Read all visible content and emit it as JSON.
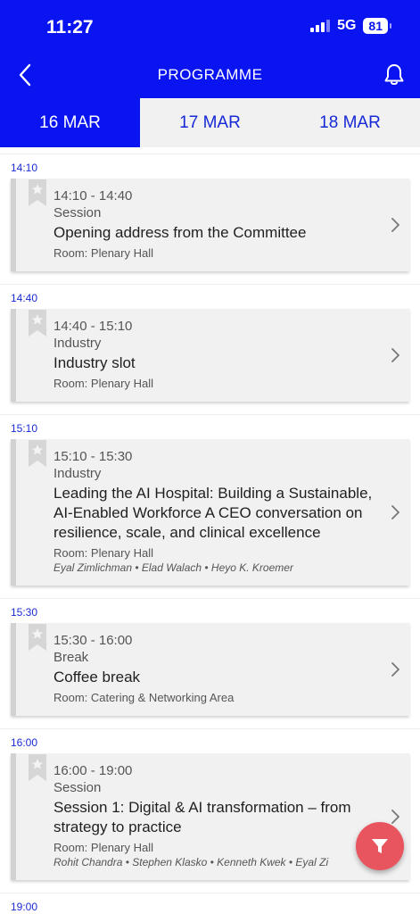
{
  "status": {
    "time": "11:27",
    "network": "5G",
    "battery": "81"
  },
  "header": {
    "title": "PROGRAMME",
    "back_icon": "chevron-left-icon",
    "bell_icon": "bell-icon"
  },
  "tabs": [
    {
      "label": "16 MAR",
      "active": true
    },
    {
      "label": "17 MAR",
      "active": false
    },
    {
      "label": "18 MAR",
      "active": false
    }
  ],
  "slots": [
    {
      "heading": "14:10",
      "time": "14:10 - 14:40",
      "type": "Session",
      "title": "Opening address from the Committee",
      "room": "Room: Plenary Hall",
      "speakers": ""
    },
    {
      "heading": "14:40",
      "time": "14:40 - 15:10",
      "type": "Industry",
      "title": "Industry slot",
      "room": "Room: Plenary Hall",
      "speakers": ""
    },
    {
      "heading": "15:10",
      "time": "15:10 - 15:30",
      "type": "Industry",
      "title": "Leading the AI Hospital: Building a Sustainable, AI-Enabled Workforce A CEO conversation on resilience, scale, and clinical excellence",
      "room": "Room: Plenary Hall",
      "speakers": "Eyal Zimlichman • Elad Walach • Heyo K. Kroemer"
    },
    {
      "heading": "15:30",
      "time": "15:30 - 16:00",
      "type": "Break",
      "title": "Coffee break",
      "room": "Room: Catering & Networking Area",
      "speakers": ""
    },
    {
      "heading": "16:00",
      "time": "16:00 - 19:00",
      "type": "Session",
      "title": "Session 1: Digital & AI transformation – from strategy to practice",
      "room": "Room: Plenary Hall",
      "speakers": "Rohit Chandra • Stephen Klasko • Kenneth Kwek • Eyal Zi"
    }
  ],
  "next_heading": "19:00",
  "fab": {
    "icon": "filter-icon"
  },
  "colors": {
    "primary": "#0a14f0",
    "fab": "#e8555f",
    "card": "#f1f1f1"
  }
}
